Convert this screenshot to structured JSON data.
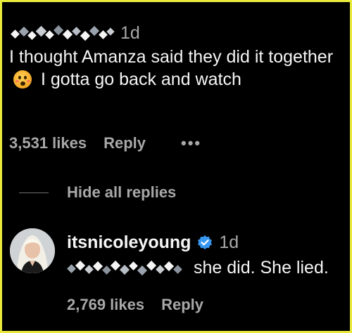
{
  "comment": {
    "time": "1d",
    "text_before_emoji": "I thought Amanza said they did it together",
    "emoji": "flushed-face-emoji",
    "text_after_emoji": "I gotta go back and watch",
    "likes": "3,531 likes",
    "reply_label": "Reply",
    "more_icon": "more-horizontal-icon"
  },
  "thread": {
    "hide_replies_label": "Hide all replies"
  },
  "reply": {
    "username": "itsnicoleyoung",
    "verified_icon": "verified-badge-icon",
    "time": "1d",
    "text": "she did. She lied.",
    "likes": "2,769 likes",
    "reply_label": "Reply"
  },
  "colors": {
    "background": "#000000",
    "frame_border": "#e9ea3c",
    "primary_text": "#f5f5f5",
    "secondary_text": "#a8a8a8",
    "verified_blue": "#3897f0",
    "redaction": "#9aa3ad"
  }
}
